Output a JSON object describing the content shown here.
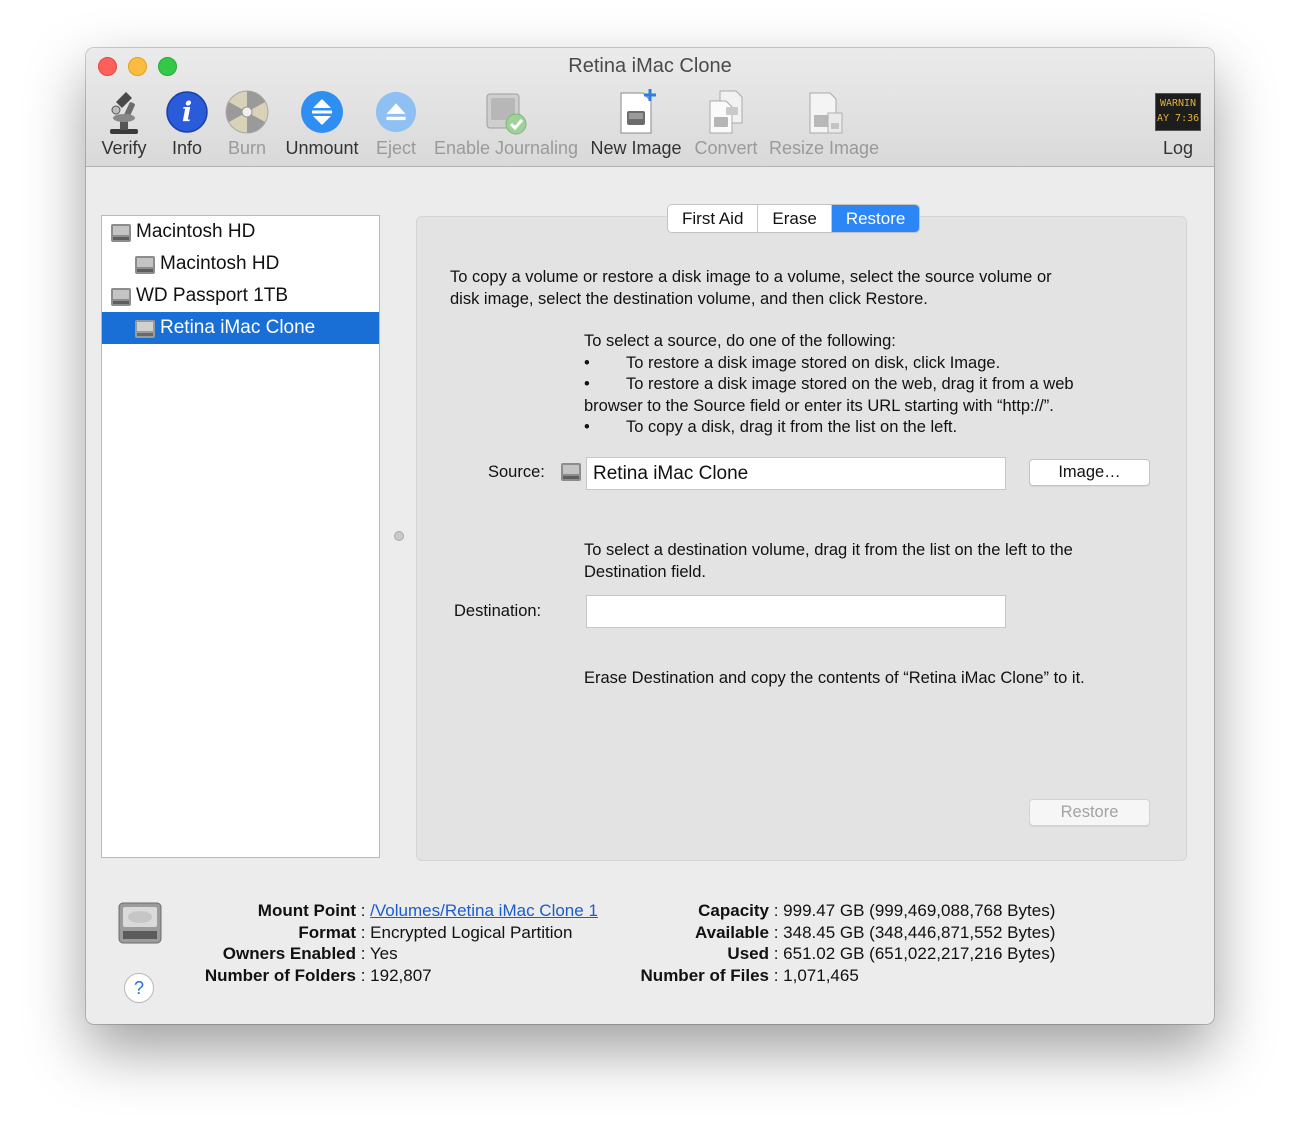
{
  "window": {
    "title": "Retina iMac Clone"
  },
  "toolbar": {
    "verify": "Verify",
    "info": "Info",
    "burn": "Burn",
    "unmount": "Unmount",
    "eject": "Eject",
    "enable_journaling": "Enable Journaling",
    "new_image": "New Image",
    "convert": "Convert",
    "resize_image": "Resize Image",
    "log": "Log",
    "log_icon_text": [
      "WARNIN",
      "AY 7:36"
    ]
  },
  "sidebar": {
    "items": [
      {
        "label": "Macintosh HD",
        "level": 0,
        "selected": false
      },
      {
        "label": "Macintosh HD",
        "level": 1,
        "selected": false
      },
      {
        "label": "WD Passport 1TB",
        "level": 0,
        "selected": false
      },
      {
        "label": "Retina iMac Clone",
        "level": 1,
        "selected": true
      }
    ]
  },
  "tabs": [
    {
      "label": "First Aid",
      "active": false
    },
    {
      "label": "Erase",
      "active": false
    },
    {
      "label": "Restore",
      "active": true
    }
  ],
  "restore": {
    "intro_line1": "To copy a volume or restore a disk image to a volume, select the source volume or",
    "intro_line2": "disk image, select the destination volume, and then click Restore.",
    "source_heading": "To select a source, do one of the following:",
    "bullet_symbol": "•",
    "bullet1": "To restore a disk image stored on disk, click Image.",
    "bullet2_line1": "To restore a disk image stored on the web, drag it from a web",
    "bullet2_line2": "browser to the Source field or enter its URL starting with “http://”.",
    "bullet3": "To copy a disk, drag it from the list on the left.",
    "source_label": "Source:",
    "source_value": "Retina iMac Clone",
    "image_button": "Image…",
    "dest_help_line1": "To select a destination volume, drag it from the list on the left to the",
    "dest_help_line2": "Destination field.",
    "destination_label": "Destination:",
    "destination_value": "",
    "summary": "Erase Destination and copy the contents of “Retina iMac Clone” to it.",
    "restore_button": "Restore"
  },
  "info": {
    "mount_point_label": "Mount Point",
    "mount_point": "/Volumes/Retina iMac Clone 1",
    "format_label": "Format",
    "format": "Encrypted Logical Partition",
    "owners_label": "Owners Enabled",
    "owners": "Yes",
    "folders_label": "Number of Folders",
    "folders": "192,807",
    "capacity_label": "Capacity",
    "capacity": "999.47 GB (999,469,088,768 Bytes)",
    "available_label": "Available",
    "available": "348.45 GB (348,446,871,552 Bytes)",
    "used_label": "Used",
    "used": "651.02 GB (651,022,217,216 Bytes)",
    "files_label": "Number of Files",
    "files": "1,071,465",
    "separator": " : "
  },
  "help": {
    "label": "?"
  }
}
